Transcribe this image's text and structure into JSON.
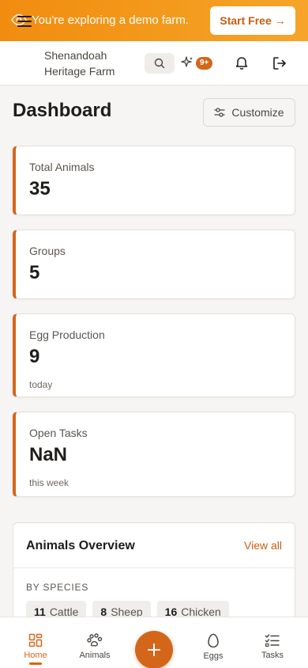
{
  "banner": {
    "message": "You're exploring a demo farm.",
    "cta_label": "Start Free →",
    "bg_color": "#f39a1c"
  },
  "header": {
    "farm_name": "Shenandoah Heritage Farm",
    "notification_badge": "9+",
    "accent_color": "#d4661a"
  },
  "dashboard": {
    "title": "Dashboard",
    "customize_label": "Customize"
  },
  "cards": [
    {
      "label": "Total Animals",
      "value": "35",
      "sub": ""
    },
    {
      "label": "Groups",
      "value": "5",
      "sub": ""
    },
    {
      "label": "Egg Production",
      "value": "9",
      "sub": "today"
    },
    {
      "label": "Open Tasks",
      "value": "NaN",
      "sub": "this week"
    }
  ],
  "overview": {
    "title": "Animals Overview",
    "view_all_label": "View all",
    "section_label": "BY SPECIES",
    "species": [
      {
        "count": "11",
        "name": "Cattle"
      },
      {
        "count": "8",
        "name": "Sheep"
      },
      {
        "count": "16",
        "name": "Chicken"
      }
    ]
  },
  "nav": {
    "home": "Home",
    "animals": "Animals",
    "eggs": "Eggs",
    "tasks": "Tasks",
    "active": "home"
  }
}
